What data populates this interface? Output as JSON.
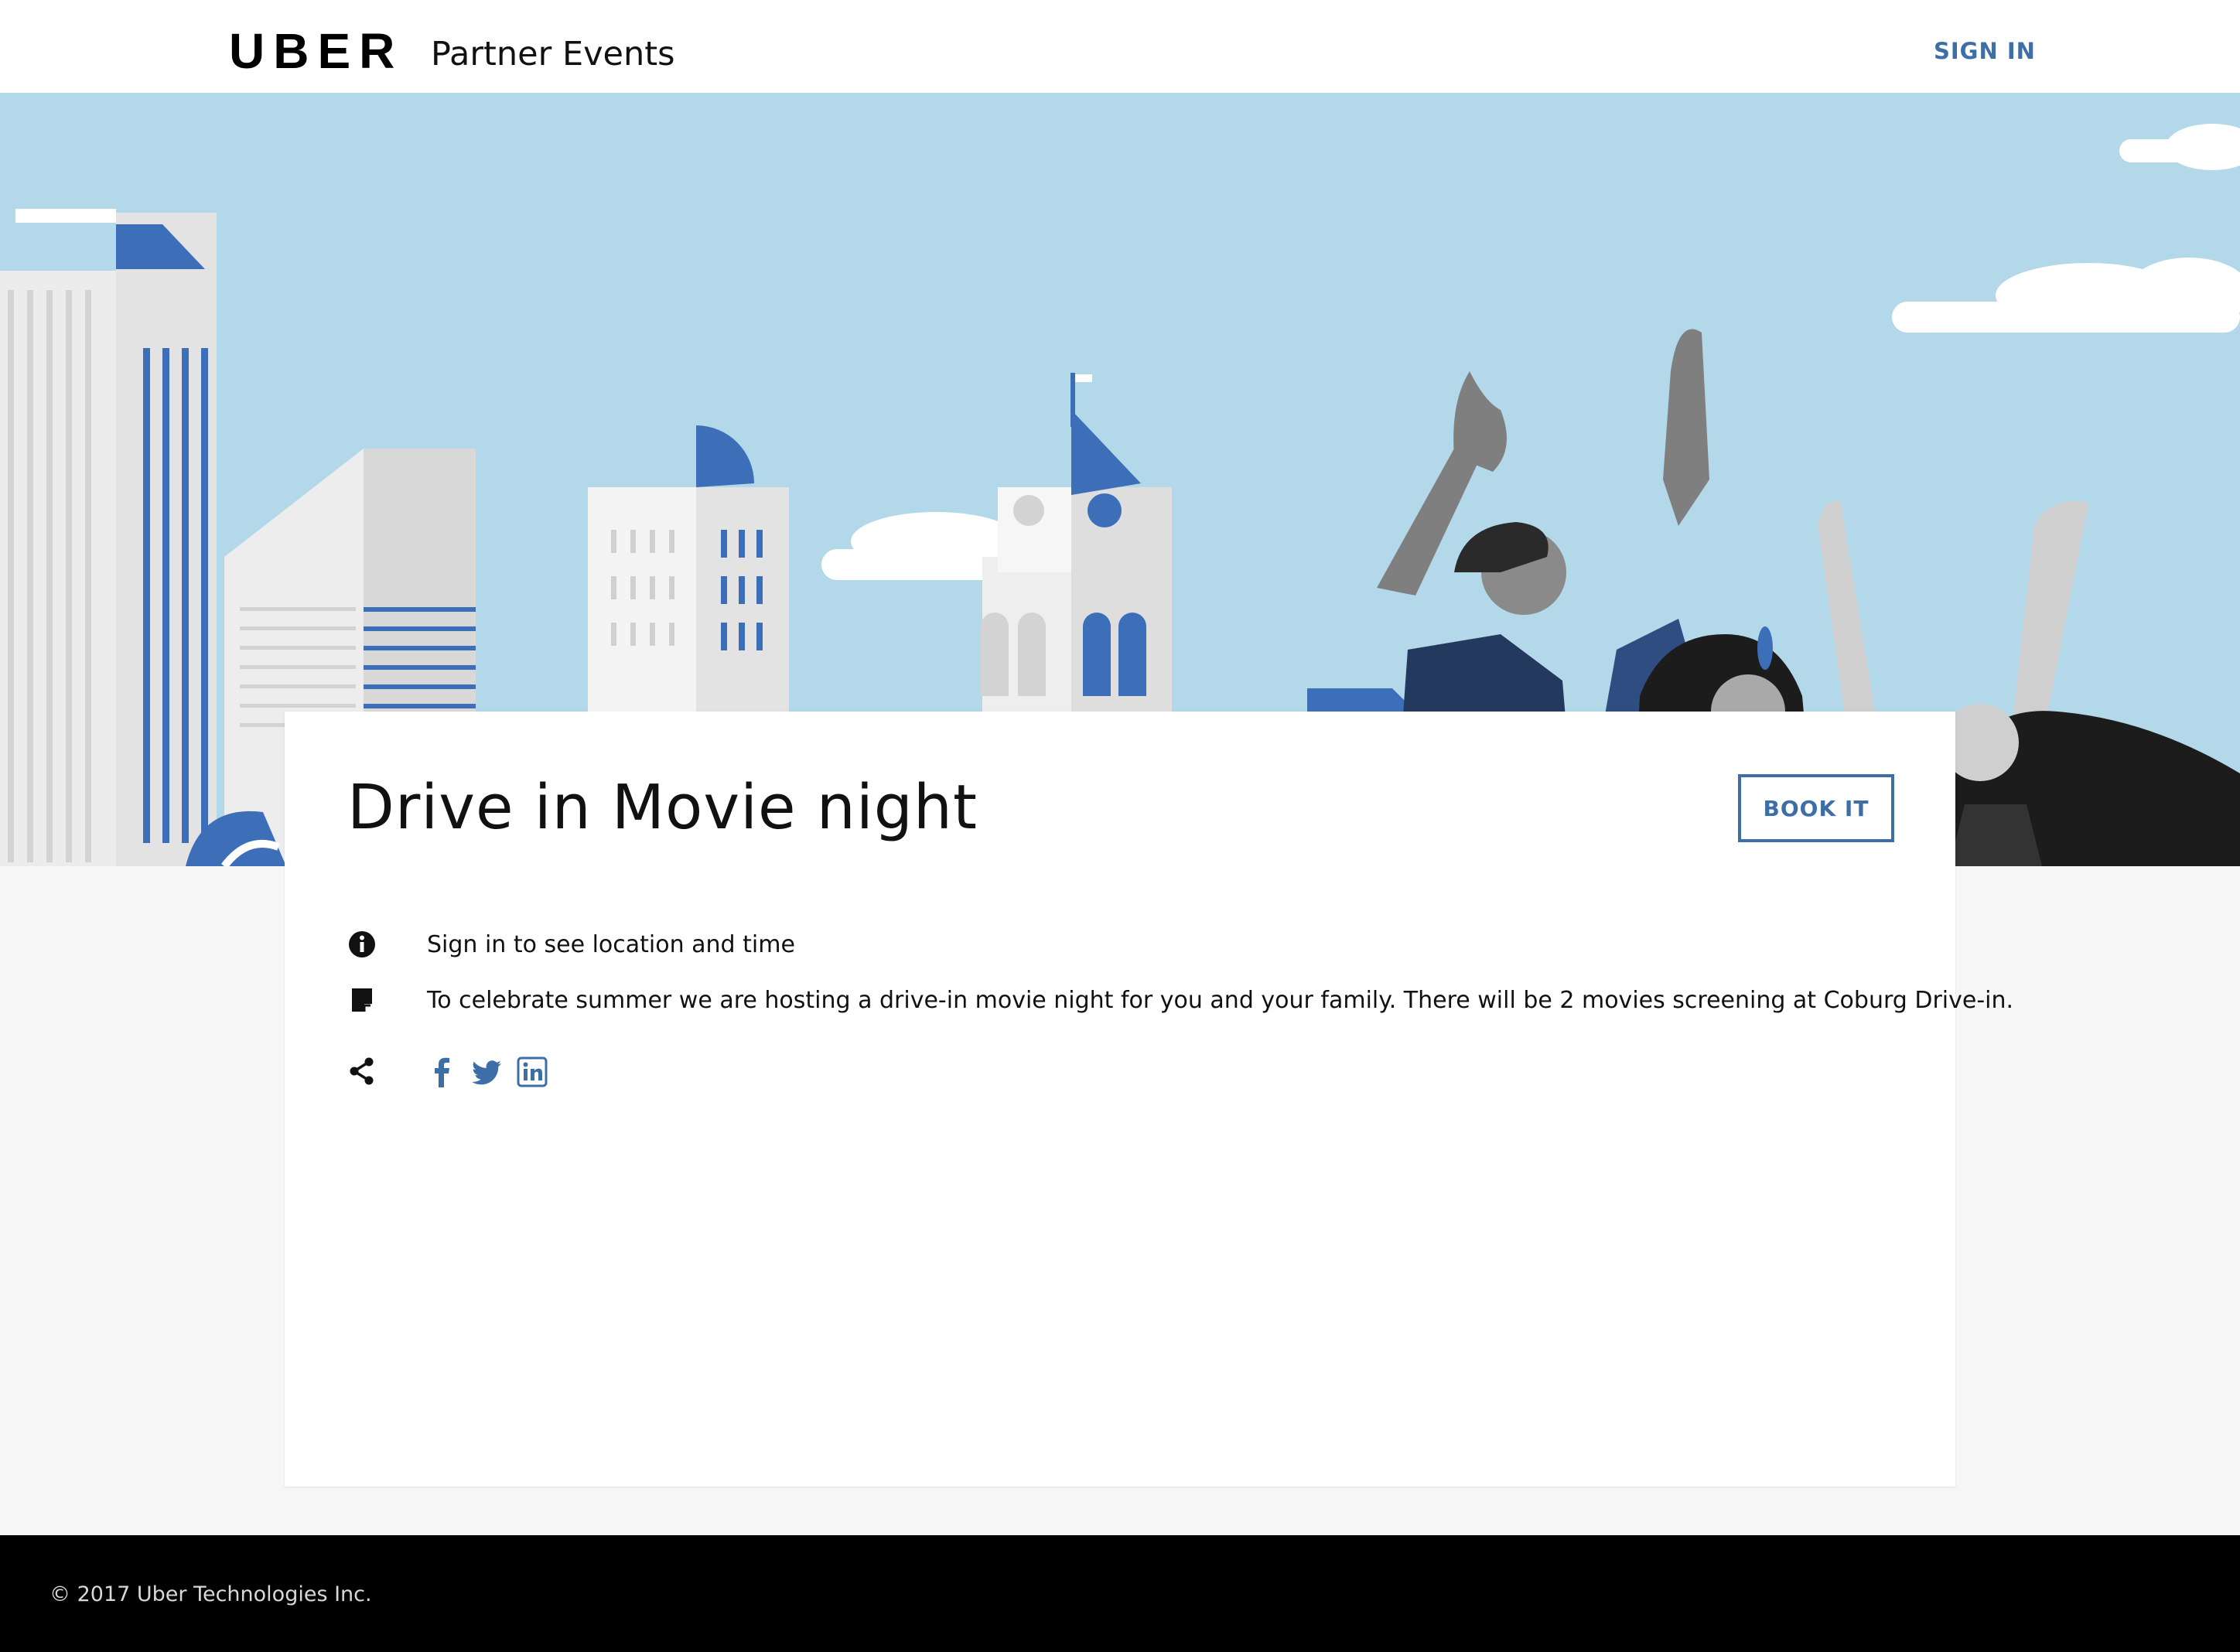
{
  "header": {
    "logo": "UBER",
    "product_name": "Partner Events",
    "sign_in_label": "SIGN IN"
  },
  "event": {
    "title": "Drive in Movie night",
    "book_label": "BOOK IT",
    "location_info": "Sign in to see location and time",
    "description": "To celebrate summer we are hosting a drive-in movie night for you and your family. There will be 2 movies screening at Coburg Drive-in."
  },
  "share": {
    "icons": [
      "facebook-icon",
      "twitter-icon",
      "linkedin-icon"
    ]
  },
  "footer": {
    "copyright": "© 2017 Uber Technologies Inc."
  },
  "colors": {
    "accent": "#3d6fa6",
    "sky": "#b3d8e9",
    "footer_bg": "#000000",
    "page_bg": "#f6f6f6"
  }
}
